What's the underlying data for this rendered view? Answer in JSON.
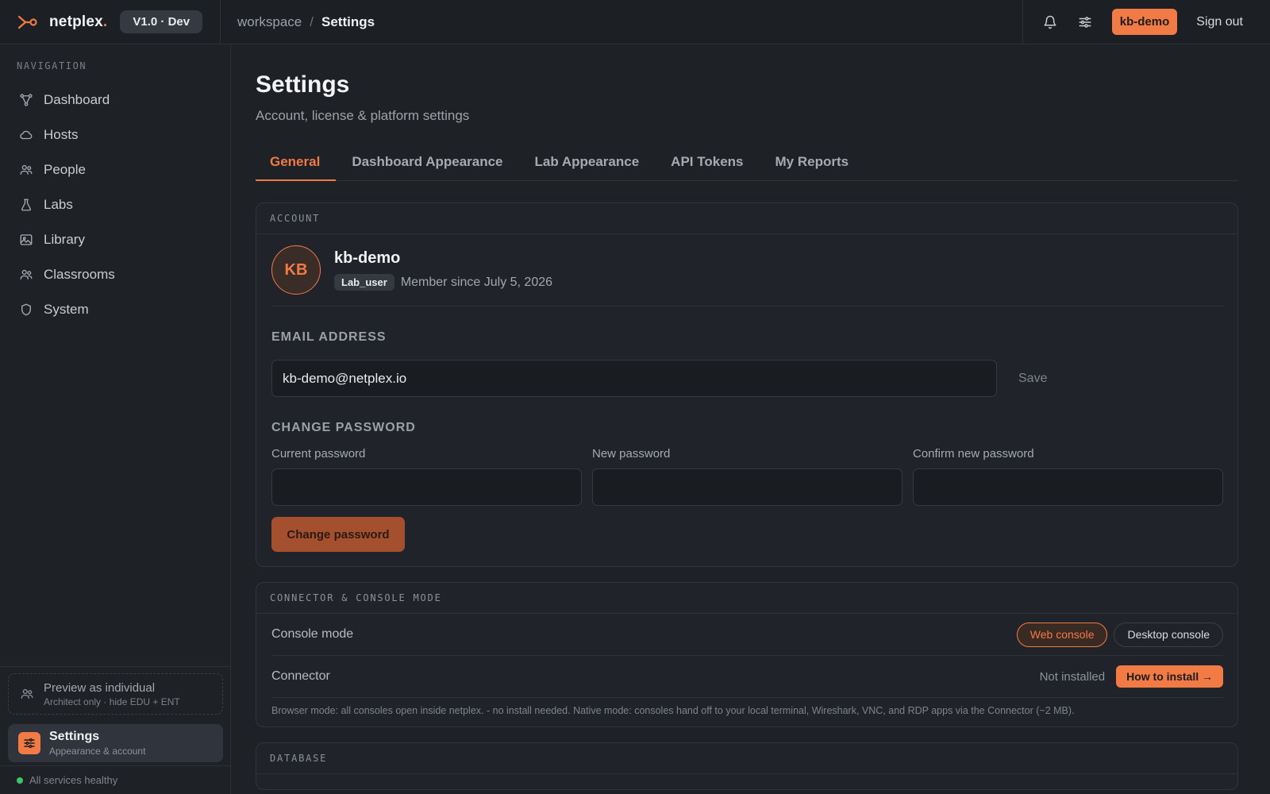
{
  "brand": {
    "name": "netplex",
    "dot": ".",
    "version": "V1.0 · Dev"
  },
  "breadcrumb": {
    "root": "workspace",
    "separator": "/",
    "current": "Settings"
  },
  "topbar": {
    "user": "kb-demo",
    "signout": "Sign out",
    "icons": [
      "bell-icon",
      "sliders-icon"
    ]
  },
  "sidebar": {
    "heading": "NAVIGATION",
    "items": [
      {
        "label": "Dashboard",
        "icon": "graph-nodes-icon"
      },
      {
        "label": "Hosts",
        "icon": "cloud-icon"
      },
      {
        "label": "People",
        "icon": "people-icon"
      },
      {
        "label": "Labs",
        "icon": "flask-icon"
      },
      {
        "label": "Library",
        "icon": "image-icon"
      },
      {
        "label": "Classrooms",
        "icon": "users-icon"
      },
      {
        "label": "System",
        "icon": "shield-icon"
      }
    ],
    "preview": {
      "title": "Preview as individual",
      "subtitle": "Architect only · hide EDU + ENT"
    },
    "settings": {
      "title": "Settings",
      "subtitle": "Appearance & account"
    },
    "health": "All services healthy"
  },
  "page": {
    "title": "Settings",
    "subtitle": "Account, license & platform settings",
    "tabs": [
      "General",
      "Dashboard Appearance",
      "Lab Appearance",
      "API Tokens",
      "My Reports"
    ],
    "active_tab": "General"
  },
  "account": {
    "header": "ACCOUNT",
    "initials": "KB",
    "username": "kb-demo",
    "role": "Lab_user",
    "member_since": "Member since July 5, 2026",
    "email_label": "EMAIL ADDRESS",
    "email_value": "kb-demo@netplex.io",
    "save": "Save",
    "password_label": "CHANGE PASSWORD",
    "current_pw": "Current password",
    "new_pw": "New password",
    "confirm_pw": "Confirm new password",
    "change_btn": "Change password"
  },
  "connector": {
    "header": "CONNECTOR & CONSOLE MODE",
    "console_label": "Console mode",
    "web_console": "Web console",
    "desktop_console": "Desktop console",
    "connector_label": "Connector",
    "status": "Not installed",
    "install_btn": "How to install →",
    "note": "Browser mode: all consoles open inside netplex. - no install needed. Native mode: consoles hand off to your local terminal, Wireshark, VNC, and RDP apps via the Connector (~2 MB)."
  },
  "database": {
    "header": "DATABASE"
  },
  "colors": {
    "accent": "#f27a45",
    "background": "#1e2126",
    "healthy": "#3ec46d"
  }
}
